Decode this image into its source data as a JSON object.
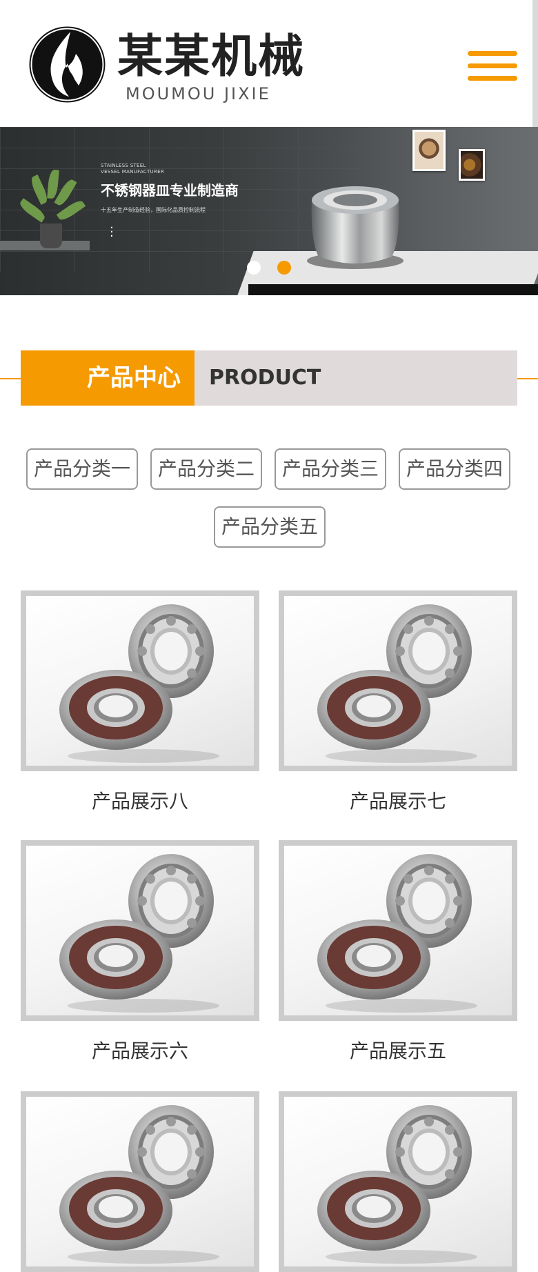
{
  "header": {
    "logo_cn": "某某机械",
    "logo_en": "MOUMOU JIXIE",
    "menu_icon": "hamburger-menu-icon"
  },
  "banner": {
    "small_line1": "STAINLESS STEEL",
    "small_line2": "VESSEL MANUFACTURER",
    "title": "不锈钢器皿专业制造商",
    "subtitle": "十五年生产制造经验，国际化品质控制流程",
    "active_slide": 2,
    "slide_count": 2
  },
  "section": {
    "title_cn": "产品中心",
    "title_en": "PRODUCT"
  },
  "categories": [
    "产品分类一",
    "产品分类二",
    "产品分类三",
    "产品分类四",
    "产品分类五"
  ],
  "products": [
    "产品展示八",
    "产品展示七",
    "产品展示六",
    "产品展示五",
    "",
    ""
  ],
  "colors": {
    "accent": "#f59a00",
    "title_bg": "#e0dbda",
    "card_border": "#cccccc"
  }
}
